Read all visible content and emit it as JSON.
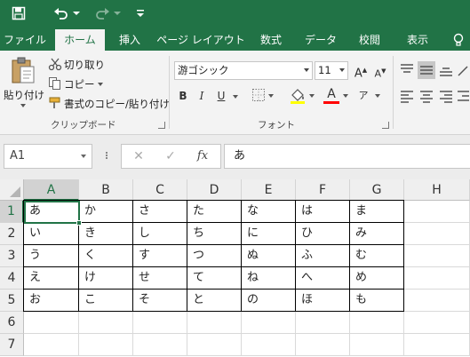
{
  "colors": {
    "brand": "#217346",
    "ribbon_bg": "#f3f3f3",
    "underline_red": "#ff0000"
  },
  "quick_access": {
    "save_icon": "save-icon",
    "undo_icon": "undo-icon",
    "redo_icon": "redo-icon",
    "customize_icon": "customize-qat-icon"
  },
  "tabs": [
    {
      "label": "ファイル",
      "active": false
    },
    {
      "label": "ホーム",
      "active": true
    },
    {
      "label": "挿入",
      "active": false
    },
    {
      "label": "ページ レイアウト",
      "active": false
    },
    {
      "label": "数式",
      "active": false
    },
    {
      "label": "データ",
      "active": false
    },
    {
      "label": "校閲",
      "active": false
    },
    {
      "label": "表示",
      "active": false
    }
  ],
  "clipboard": {
    "paste_label": "貼り付け",
    "cut_label": "切り取り",
    "copy_label": "コピー",
    "format_painter_label": "書式のコピー/貼り付け",
    "group_label": "クリップボード"
  },
  "font": {
    "name": "游ゴシック",
    "size": "11",
    "bold": "B",
    "italic": "I",
    "underline": "U",
    "group_label": "フォント"
  },
  "formula_bar": {
    "name_box": "A1",
    "cancel_symbol": "✕",
    "enter_symbol": "✓",
    "fx_label": "fx",
    "content": "あ"
  },
  "sheet": {
    "columns": [
      "A",
      "B",
      "C",
      "D",
      "E",
      "F",
      "G",
      "H"
    ],
    "rows": [
      "1",
      "2",
      "3",
      "4",
      "5",
      "6",
      "7"
    ],
    "cells": [
      [
        "あ",
        "か",
        "さ",
        "た",
        "な",
        "は",
        "ま"
      ],
      [
        "い",
        "き",
        "し",
        "ち",
        "に",
        "ひ",
        "み"
      ],
      [
        "う",
        "く",
        "す",
        "つ",
        "ぬ",
        "ふ",
        "む"
      ],
      [
        "え",
        "け",
        "せ",
        "て",
        "ね",
        "へ",
        "め"
      ],
      [
        "お",
        "こ",
        "そ",
        "と",
        "の",
        "ほ",
        "も"
      ]
    ],
    "selected_cell": "A1"
  }
}
